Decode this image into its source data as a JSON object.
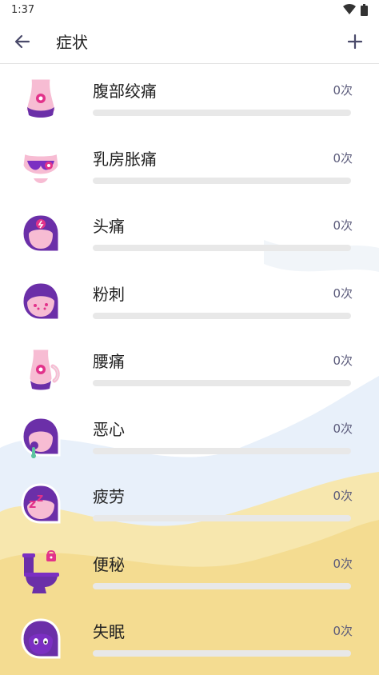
{
  "status_bar": {
    "time": "1:37"
  },
  "app_bar": {
    "title": "症状"
  },
  "colors": {
    "accent": "#7b2fc2",
    "purple": "#6b2fa8",
    "pink": "#f7bcd3",
    "sand": "#f6e2a0",
    "sky": "#e6eef8"
  },
  "symptoms": [
    {
      "label": "腹部绞痛",
      "count": "0次",
      "progress": 0,
      "icon": "abdomen-cramp-icon"
    },
    {
      "label": "乳房胀痛",
      "count": "0次",
      "progress": 0,
      "icon": "breast-tenderness-icon"
    },
    {
      "label": "头痛",
      "count": "0次",
      "progress": 0,
      "icon": "headache-icon"
    },
    {
      "label": "粉刺",
      "count": "0次",
      "progress": 0,
      "icon": "acne-icon"
    },
    {
      "label": "腰痛",
      "count": "0次",
      "progress": 0,
      "icon": "back-pain-icon"
    },
    {
      "label": "恶心",
      "count": "0次",
      "progress": 0,
      "icon": "nausea-icon"
    },
    {
      "label": "疲劳",
      "count": "0次",
      "progress": 0,
      "icon": "fatigue-icon"
    },
    {
      "label": "便秘",
      "count": "0次",
      "progress": 0,
      "icon": "constipation-icon"
    },
    {
      "label": "失眠",
      "count": "0次",
      "progress": 0,
      "icon": "insomnia-icon"
    }
  ]
}
